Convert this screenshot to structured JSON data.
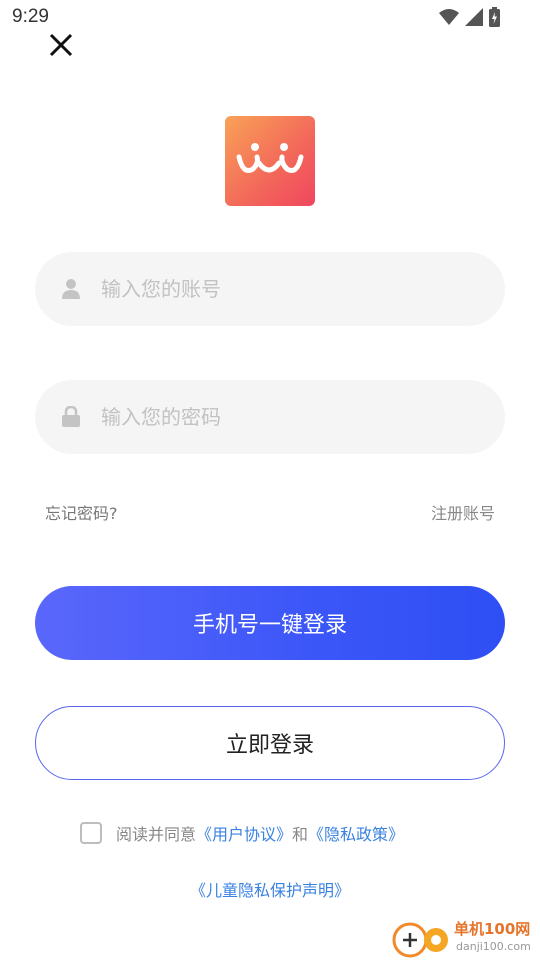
{
  "status_bar": {
    "time": "9:29"
  },
  "form": {
    "account_placeholder": "输入您的账号",
    "password_placeholder": "输入您的密码",
    "forgot_password": "忘记密码?",
    "register": "注册账号"
  },
  "buttons": {
    "phone_login": "手机号一键登录",
    "login": "立即登录"
  },
  "agreement": {
    "prefix": "阅读并同意",
    "user_agreement": "《用户协议》",
    "and": "和",
    "privacy_policy": "《隐私政策》",
    "child_privacy": "《儿童隐私保护声明》",
    "checked": false
  },
  "watermark": {
    "brand": "单机100网",
    "domain": "danji100.com"
  },
  "colors": {
    "primary": "#3b56f8",
    "link": "#3b82e0",
    "logo_gradient": [
      "#f9a257",
      "#f0465e"
    ]
  }
}
